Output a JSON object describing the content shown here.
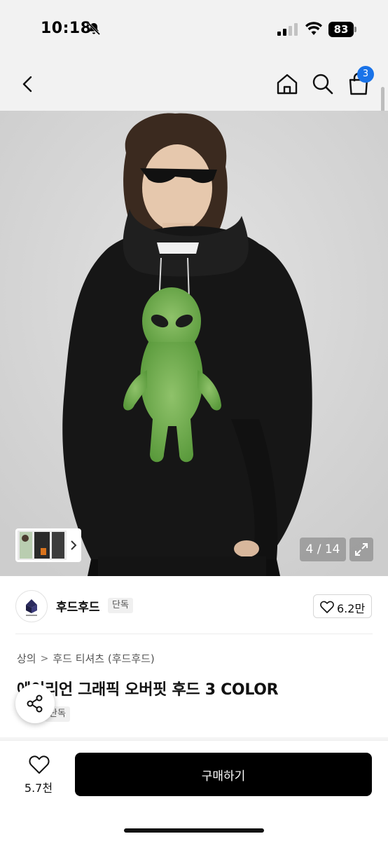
{
  "status_bar": {
    "time": "10:18",
    "battery": "83"
  },
  "nav": {
    "cart_count": "3",
    "icons": [
      "chevron-left-icon",
      "home-icon",
      "search-icon",
      "cart-icon"
    ]
  },
  "gallery": {
    "counter": "4 / 14",
    "current_index": 4,
    "total": 14
  },
  "brand": {
    "name": "후드후드",
    "badge": "단독",
    "likes": "6.2만"
  },
  "breadcrumb": [
    "상의",
    "후드 티셔츠 (후드후드)"
  ],
  "breadcrumb_separator": ">",
  "product": {
    "title": "에이리언 그래픽 오버핏 후드 3 COLOR",
    "badge": "단독"
  },
  "bottom_bar": {
    "wish_count": "5.7천",
    "buy_label": "구매하기"
  },
  "colors": {
    "accent_badge": "#1a73e8",
    "buy_button": "#000000",
    "header_bg": "#f2f2f2"
  }
}
